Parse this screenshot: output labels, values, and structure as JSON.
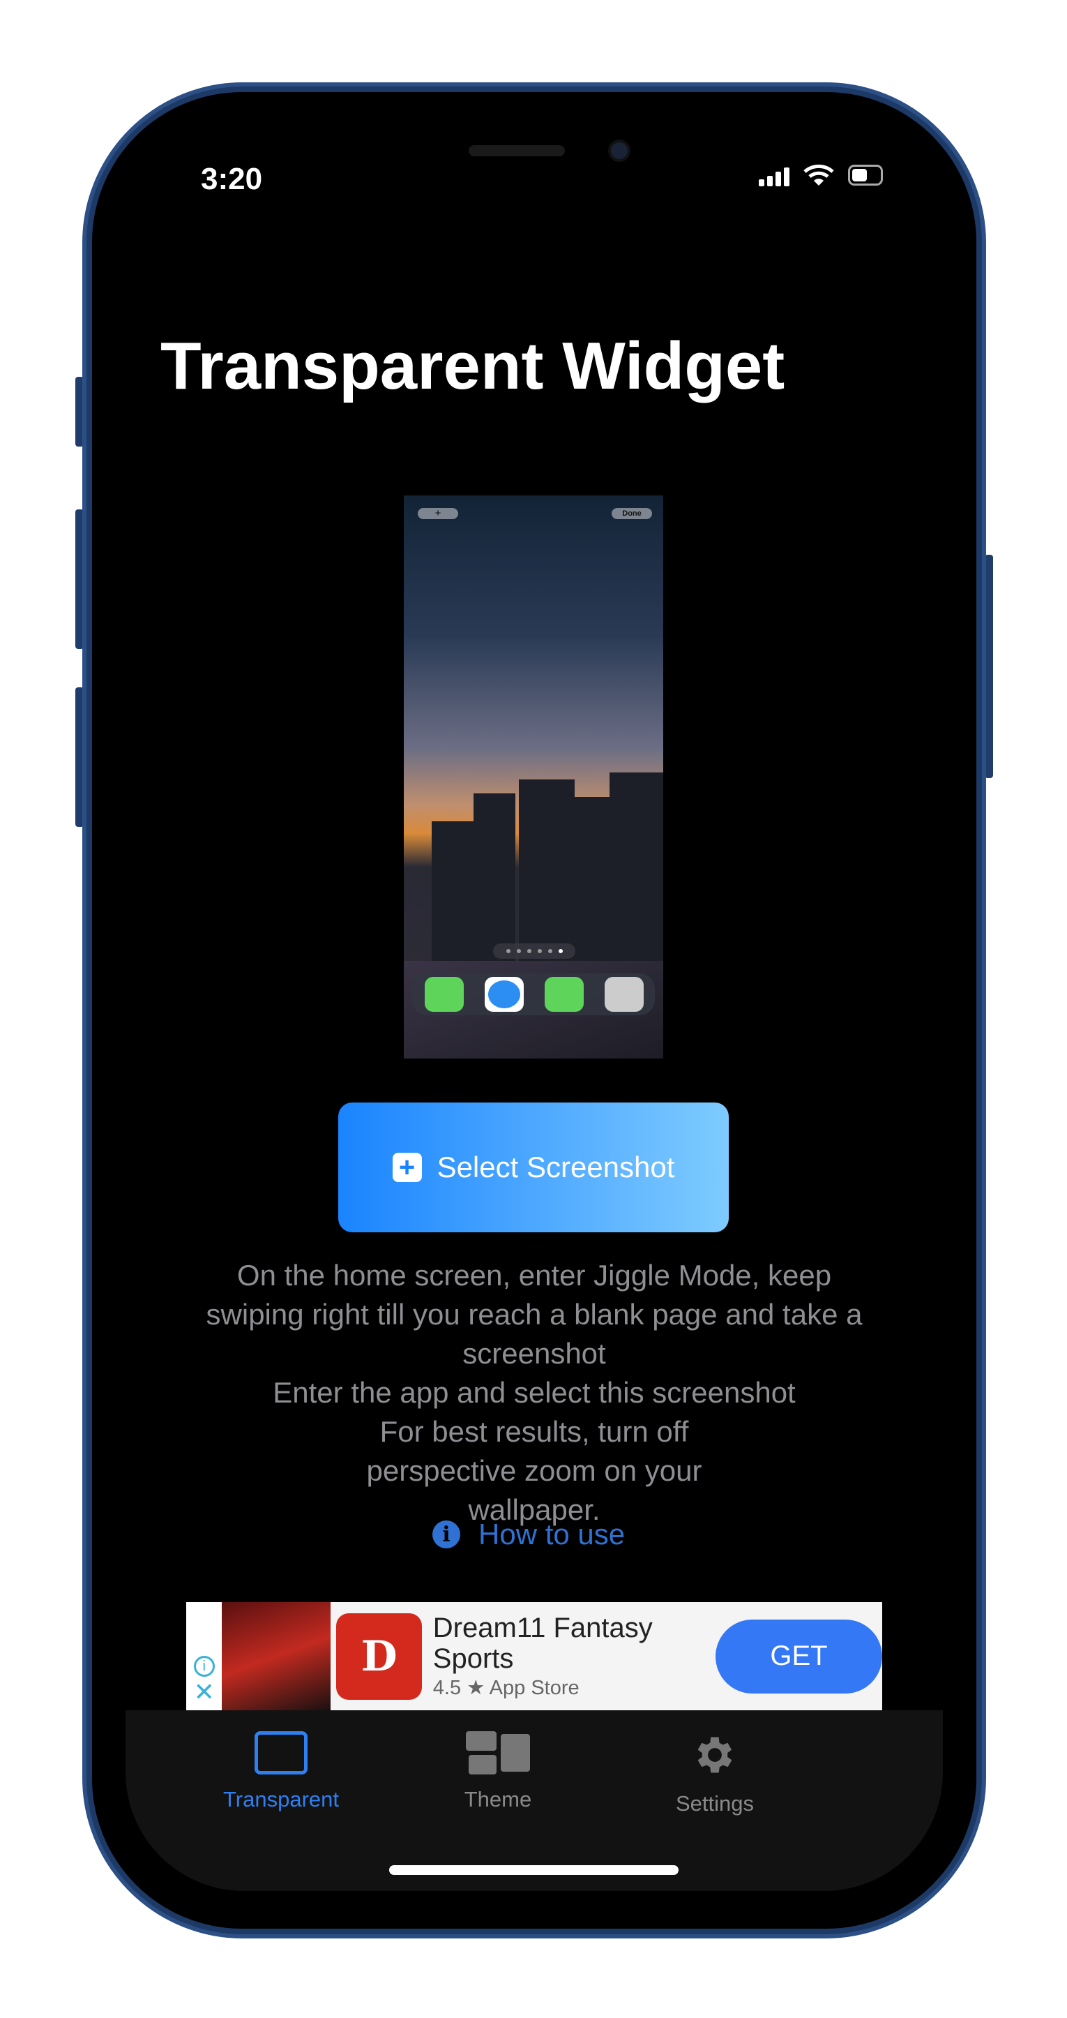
{
  "status_bar": {
    "time": "3:20",
    "icons": [
      "cellular-signal-icon",
      "wifi-icon",
      "battery-icon"
    ]
  },
  "title": "Transparent Widget",
  "preview": {
    "top_left_button": "+",
    "top_right_button": "Done",
    "page_dots": 6,
    "active_dot": 6,
    "dock_apps": [
      "phone-icon",
      "safari-icon",
      "whatsapp-icon",
      "camera-icon"
    ]
  },
  "select_button": {
    "label": "Select Screenshot",
    "icon": "plus-square-icon"
  },
  "instructions": [
    "On the home screen, enter Jiggle Mode, keep swiping right till you reach a blank page and take a screenshot",
    "Enter the app and select this screenshot",
    "For best results, turn off perspective zoom on your wallpaper."
  ],
  "how_to_use": "How to use",
  "ad": {
    "title": "Dream11 Fantasy Sports",
    "rating": "4.5",
    "rating_star": "★",
    "store": "App Store",
    "cta": "GET",
    "cta_color": "#3478f6"
  },
  "tabs": [
    {
      "label": "Transparent",
      "active": true
    },
    {
      "label": "Theme",
      "active": false
    },
    {
      "label": "Settings",
      "active": false
    }
  ],
  "colors": {
    "accent": "#2f7ff0",
    "tab_inactive": "#8a8a8a"
  }
}
